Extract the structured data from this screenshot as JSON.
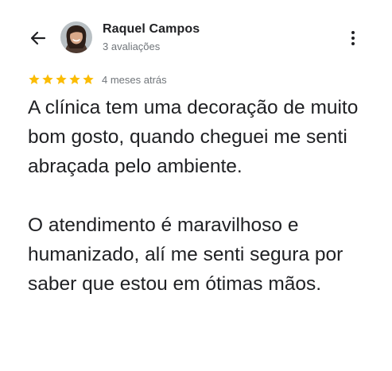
{
  "header": {
    "back_icon": "arrow-back-icon",
    "author_name": "Raquel Campos",
    "review_count": "3 avaliações",
    "more_icon": "more-vert-icon"
  },
  "review": {
    "rating": 5,
    "rating_max": 5,
    "star_color": "#fbbc04",
    "date": "4 meses atrás",
    "paragraphs": [
      "A clínica tem uma decoração de muito bom gosto, quando cheguei me senti abraçada pelo ambiente.",
      "O atendimento é maravilhoso e humanizado, alí me senti segura por saber que estou em ótimas mãos."
    ]
  }
}
